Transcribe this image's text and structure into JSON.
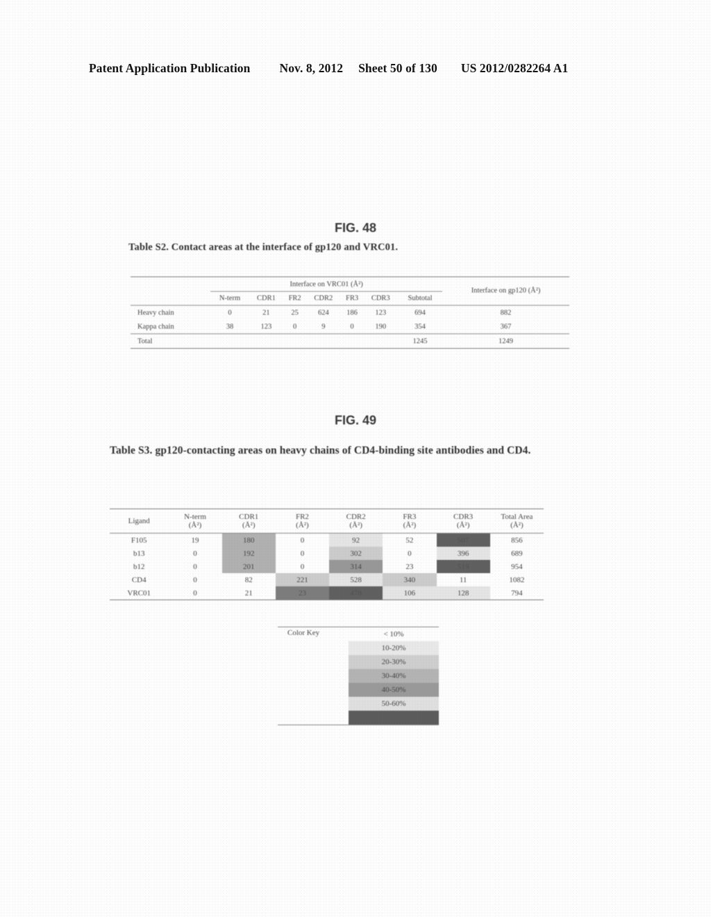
{
  "header": {
    "publication": "Patent Application Publication",
    "date": "Nov. 8, 2012",
    "sheet": "Sheet 50 of 130",
    "doc_number": "US 2012/0282264 A1"
  },
  "figures": [
    {
      "label": "FIG. 48",
      "caption": "Table S2.  Contact areas at the interface of gp120 and VRC01.",
      "table": {
        "group_header": "Interface on VRC01 (Å²)",
        "last_col_header": "Interface on gp120 (Å²)",
        "columns": [
          "N-term",
          "CDR1",
          "FR2",
          "CDR2",
          "FR3",
          "CDR3",
          "Subtotal"
        ],
        "rows": [
          {
            "label": "Heavy chain",
            "values": [
              "0",
              "21",
              "25",
              "624",
              "186",
              "123",
              "694"
            ],
            "gp120": "882"
          },
          {
            "label": "Kappa chain",
            "values": [
              "38",
              "123",
              "0",
              "9",
              "0",
              "190",
              "354"
            ],
            "gp120": "367"
          }
        ],
        "total_row": {
          "label": "Total",
          "subtotal": "1245",
          "gp120": "1249"
        }
      }
    },
    {
      "label": "FIG. 49",
      "caption": "Table S3. gp120-contacting areas on heavy chains of CD4-binding site antibodies and CD4.",
      "table": {
        "columns": [
          {
            "name": "Ligand",
            "unit": ""
          },
          {
            "name": "N-term",
            "unit": "(Å²)"
          },
          {
            "name": "CDR1",
            "unit": "(Å²)"
          },
          {
            "name": "FR2",
            "unit": "(Å²)"
          },
          {
            "name": "CDR2",
            "unit": "(Å²)"
          },
          {
            "name": "FR3",
            "unit": "(Å²)"
          },
          {
            "name": "CDR3",
            "unit": "(Å²)"
          },
          {
            "name": "Total Area",
            "unit": "(Å²)"
          }
        ],
        "rows": [
          {
            "ligand": "F105",
            "cells": [
              {
                "value": "19",
                "shade": 0
              },
              {
                "value": "180",
                "shade": 3
              },
              {
                "value": "0",
                "shade": 0
              },
              {
                "value": "92",
                "shade": 1
              },
              {
                "value": "52",
                "shade": 0
              },
              {
                "value": "507",
                "shade": 6
              },
              {
                "value": "856",
                "shade": 0
              }
            ]
          },
          {
            "ligand": "b13",
            "cells": [
              {
                "value": "0",
                "shade": 0
              },
              {
                "value": "192",
                "shade": 3
              },
              {
                "value": "0",
                "shade": 0
              },
              {
                "value": "302",
                "shade": 2
              },
              {
                "value": "0",
                "shade": 0
              },
              {
                "value": "396",
                "shade": 1
              },
              {
                "value": "689",
                "shade": 0
              }
            ]
          },
          {
            "ligand": "b12",
            "cells": [
              {
                "value": "0",
                "shade": 0
              },
              {
                "value": "201",
                "shade": 3
              },
              {
                "value": "0",
                "shade": 0
              },
              {
                "value": "314",
                "shade": 4
              },
              {
                "value": "23",
                "shade": 0
              },
              {
                "value": "519",
                "shade": 6
              },
              {
                "value": "954",
                "shade": 0
              }
            ]
          },
          {
            "ligand": "CD4",
            "cells": [
              {
                "value": "0",
                "shade": 0
              },
              {
                "value": "82",
                "shade": 0
              },
              {
                "value": "221",
                "shade": 2
              },
              {
                "value": "528",
                "shade": 1
              },
              {
                "value": "340",
                "shade": 2
              },
              {
                "value": "11",
                "shade": 0
              },
              {
                "value": "1082",
                "shade": 0
              }
            ]
          },
          {
            "ligand": "VRC01",
            "cells": [
              {
                "value": "0",
                "shade": 0
              },
              {
                "value": "21",
                "shade": 0
              },
              {
                "value": "23",
                "shade": 5
              },
              {
                "value": "478",
                "shade": 6
              },
              {
                "value": "106",
                "shade": 1
              },
              {
                "value": "128",
                "shade": 1
              },
              {
                "value": "794",
                "shade": 0
              }
            ]
          }
        ]
      },
      "color_key": {
        "title": "Color Key",
        "bands": [
          {
            "label": "< 10%",
            "shade": 0
          },
          {
            "label": "10-20%",
            "shade": 1
          },
          {
            "label": "20-30%",
            "shade": 2
          },
          {
            "label": "30-40%",
            "shade": 3
          },
          {
            "label": "40-50%",
            "shade": 4
          },
          {
            "label": "50-60%",
            "shade": 5
          },
          {
            "label": "> 60%",
            "shade": 6
          }
        ]
      }
    }
  ]
}
